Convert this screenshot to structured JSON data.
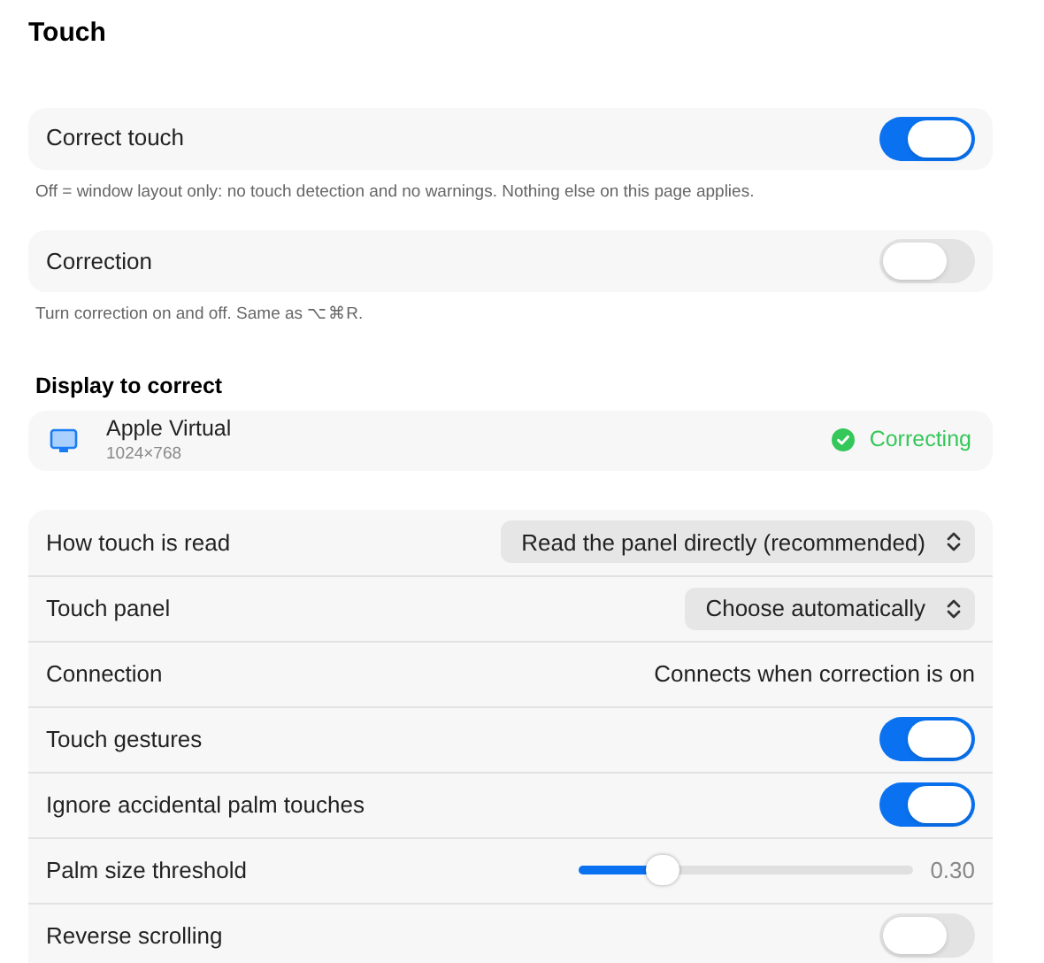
{
  "title": "Touch",
  "top_settings": [
    {
      "label": "Correct touch",
      "on": true,
      "caption": "Off = window layout only: no touch detection and no warnings. Nothing else on this page applies."
    },
    {
      "label": "Correction",
      "on": false,
      "caption": "Turn correction on and off. Same as ⌥⌘R."
    }
  ],
  "display_section": {
    "heading": "Display to correct",
    "name": "Apple Virtual",
    "resolution": "1024×768",
    "status": "Correcting"
  },
  "settings": [
    {
      "kind": "select",
      "label": "How touch is read",
      "value": "Read the panel directly (recommended)"
    },
    {
      "kind": "select",
      "label": "Touch panel",
      "value": "Choose automatically"
    },
    {
      "kind": "text",
      "label": "Connection",
      "value": "Connects when correction is on"
    },
    {
      "kind": "toggle",
      "label": "Touch gestures",
      "on": true
    },
    {
      "kind": "toggle",
      "label": "Ignore accidental palm touches",
      "on": true
    },
    {
      "kind": "slider",
      "label": "Palm size threshold",
      "level": 0.25,
      "reading": "0.30"
    },
    {
      "kind": "toggle",
      "label": "Reverse scrolling",
      "on": false
    }
  ]
}
